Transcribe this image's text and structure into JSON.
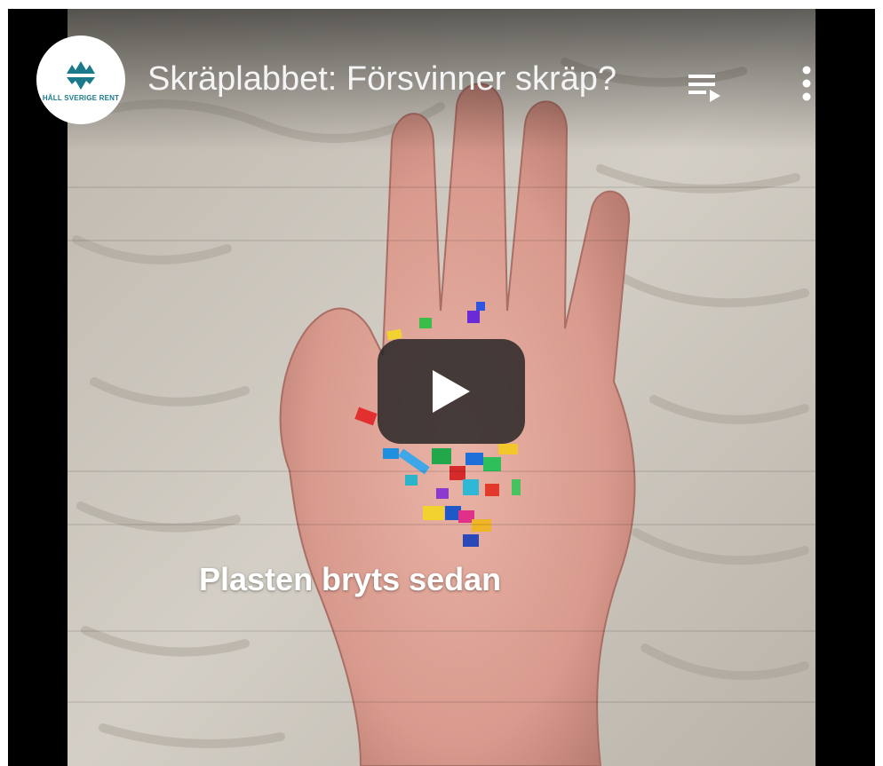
{
  "player": {
    "title": "Skräplabbet: Försvinner skräp?",
    "caption": "Plasten bryts sedan",
    "channel": {
      "logo_text": "HÅLL SVERIGE RENT",
      "logo_color": "#1a7a8a",
      "icon": "channel-logo-icon"
    },
    "controls": {
      "playlist_icon": "playlist-icon",
      "more_icon": "more-vertical-icon",
      "play_icon": "play-icon"
    }
  }
}
